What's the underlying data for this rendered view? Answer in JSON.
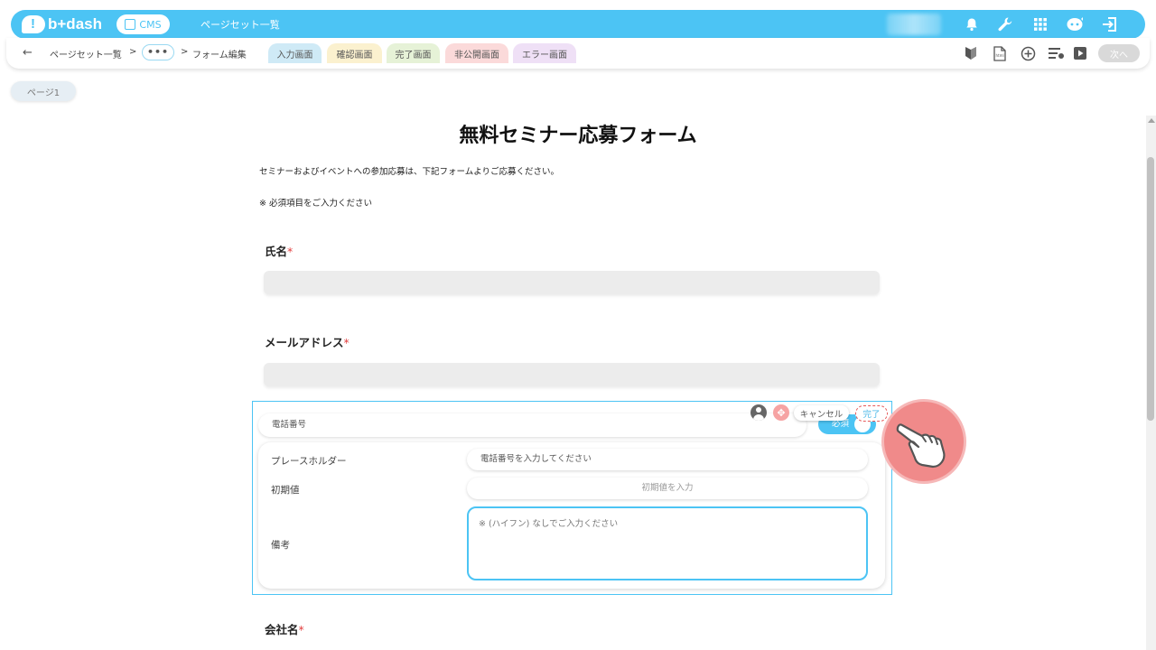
{
  "header": {
    "logo_text": "b+dash",
    "cms_label": "CMS",
    "title": "ページセット一覧",
    "icons": [
      "bell-icon",
      "wrench-icon",
      "grid-icon",
      "assistant-icon",
      "logout-icon"
    ]
  },
  "toolbar": {
    "breadcrumb_1": "ページセット一覧",
    "separator": ">",
    "ellipsis": "•••",
    "breadcrumb_2": "フォーム編集",
    "tabs": [
      {
        "label": "入力画面",
        "color": "#cfeaf6"
      },
      {
        "label": "確認画面",
        "color": "#fbf1cf"
      },
      {
        "label": "完了画面",
        "color": "#e6f2d7"
      },
      {
        "label": "非公開画面",
        "color": "#fbdada"
      },
      {
        "label": "エラー画面",
        "color": "#efe0f6"
      }
    ],
    "right_icons": [
      "beginner-icon",
      "html-file-icon",
      "add-circle-icon",
      "list-settings-icon",
      "play-icon"
    ],
    "next_label": "次へ"
  },
  "page_tab": "ページ1",
  "form": {
    "title": "無料セミナー応募フォーム",
    "intro": "セミナーおよびイベントへの参加応募は、下記フォームよりご応募ください。",
    "required_note": "※ 必須項目をご入力ください",
    "required_mark": "*",
    "fields": {
      "name_label": "氏名",
      "email_label": "メールアドレス",
      "company_label": "会社名"
    }
  },
  "editor": {
    "field_name": "電話番号",
    "required_label": "必須",
    "cancel_label": "キャンセル",
    "done_label": "完了",
    "placeholder_label": "プレースホルダー",
    "placeholder_value": "電話番号を入力してください",
    "default_label": "初期値",
    "default_placeholder": "初期値を入力",
    "note_label": "備考",
    "note_value": "※ (ハイフン) なしでご入力ください"
  },
  "colors": {
    "accent": "#4cc4f4",
    "required": "#e23d3d",
    "pointer_highlight": "#f08a8a"
  }
}
